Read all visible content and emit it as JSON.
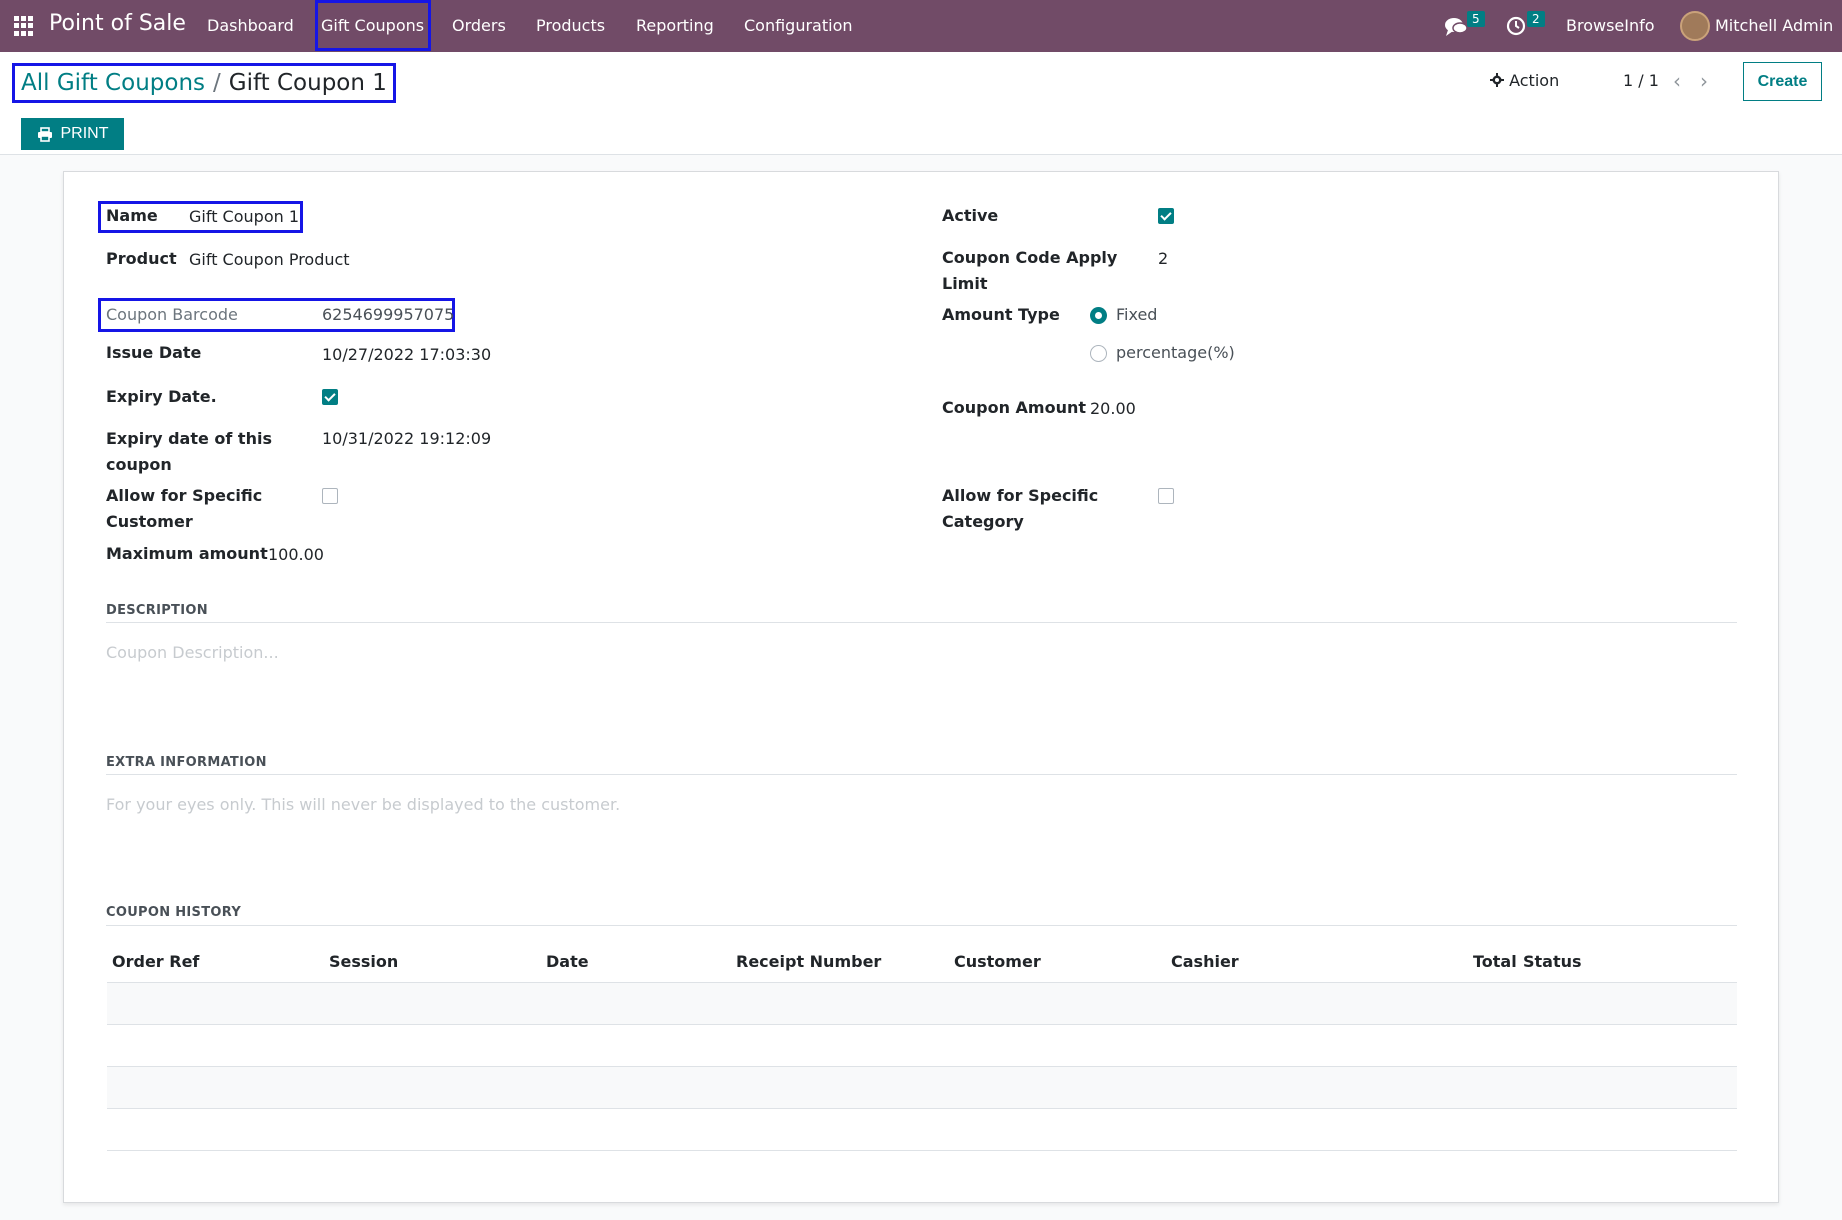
{
  "navbar": {
    "brand": "Point of Sale",
    "menu": [
      "Dashboard",
      "Gift Coupons",
      "Orders",
      "Products",
      "Reporting",
      "Configuration"
    ],
    "messages_count": "5",
    "activities_count": "2",
    "company": "BrowseInfo",
    "user": "Mitchell Admin"
  },
  "control": {
    "breadcrumb_parent": "All Gift Coupons",
    "breadcrumb_separator": "/",
    "breadcrumb_current": "Gift Coupon 1",
    "print_label": "PRINT",
    "action_label": "Action",
    "pager": "1 / 1",
    "create_label": "Create"
  },
  "form": {
    "name": {
      "label": "Name",
      "value": "Gift Coupon 1"
    },
    "product": {
      "label": "Product",
      "value": "Gift Coupon Product"
    },
    "barcode": {
      "label": "Coupon Barcode",
      "value": "6254699957075"
    },
    "issue_date": {
      "label": "Issue Date",
      "value": "10/27/2022 17:03:30"
    },
    "expiry_date_flag": {
      "label": "Expiry Date.",
      "checked": true
    },
    "expiry_date": {
      "label_line1": "Expiry date of this",
      "label_line2": "coupon",
      "value": "10/31/2022 19:12:09"
    },
    "specific_customer": {
      "label_line1": "Allow for Specific",
      "label_line2": "Customer",
      "checked": false
    },
    "max_amount": {
      "label": "Maximum amount",
      "value": "100.00"
    },
    "active": {
      "label": "Active",
      "checked": true
    },
    "apply_limit": {
      "label_line1": "Coupon Code Apply",
      "label_line2": "Limit",
      "value": "2"
    },
    "amount_type": {
      "label": "Amount Type",
      "options": [
        "Fixed",
        "percentage(%)"
      ],
      "selected": "Fixed"
    },
    "coupon_amount": {
      "label": "Coupon Amount",
      "value": "20.00"
    },
    "specific_category": {
      "label_line1": "Allow for Specific",
      "label_line2": "Category",
      "checked": false
    }
  },
  "description": {
    "title": "DESCRIPTION",
    "placeholder": "Coupon Description..."
  },
  "extra": {
    "title": "EXTRA INFORMATION",
    "placeholder": "For your eyes only. This will never be displayed to the customer."
  },
  "history": {
    "title": "COUPON HISTORY",
    "columns": [
      "Order Ref",
      "Session",
      "Date",
      "Receipt Number",
      "Customer",
      "Cashier",
      "Total",
      "Status"
    ]
  }
}
